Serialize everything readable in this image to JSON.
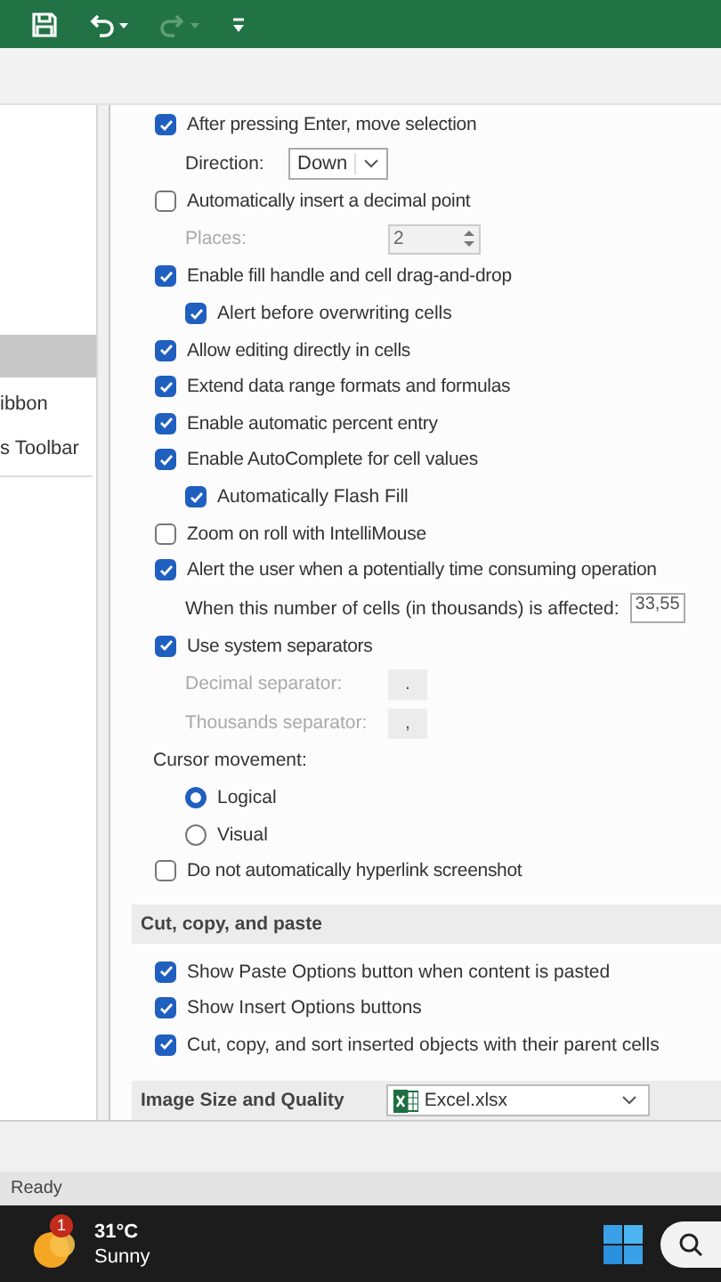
{
  "quick_access": [
    {
      "kind": "save",
      "disabled": false
    },
    {
      "kind": "undo",
      "disabled": false
    },
    {
      "kind": "redo",
      "disabled": true
    },
    {
      "kind": "customize",
      "disabled": false
    }
  ],
  "sidebar": {
    "items": [
      {
        "selected": true
      },
      {
        "label": "ibbon",
        "selected": false
      },
      {
        "label": "s Toolbar",
        "selected": false
      }
    ]
  },
  "editing_options": [
    {
      "kind": "checkbox",
      "label": "After pressing Enter, move selection",
      "checked": true,
      "children": [
        {
          "kind": "dropdown",
          "label": "Direction:",
          "value": "Down",
          "disabled": false
        }
      ]
    },
    {
      "kind": "checkbox",
      "label": "Automatically insert a decimal point",
      "checked": false,
      "children": [
        {
          "kind": "spinner",
          "label": "Places:",
          "value": "2",
          "disabled": true
        }
      ]
    },
    {
      "kind": "checkbox",
      "label": "Enable fill handle and cell drag-and-drop",
      "checked": true,
      "children": [
        {
          "kind": "checkbox",
          "label": "Alert before overwriting cells",
          "checked": true
        }
      ]
    },
    {
      "kind": "checkbox",
      "label": "Allow editing directly in cells",
      "checked": true
    },
    {
      "kind": "checkbox",
      "label": "Extend data range formats and formulas",
      "checked": true
    },
    {
      "kind": "checkbox",
      "label": "Enable automatic percent entry",
      "checked": true
    },
    {
      "kind": "checkbox",
      "label": "Enable AutoComplete for cell values",
      "checked": true,
      "children": [
        {
          "kind": "checkbox",
          "label": "Automatically Flash Fill",
          "checked": true
        }
      ]
    },
    {
      "kind": "checkbox",
      "label": "Zoom on roll with IntelliMouse",
      "checked": false
    },
    {
      "kind": "checkbox",
      "label": "Alert the user when a potentially time consuming operation",
      "checked": true,
      "children": [
        {
          "kind": "number",
          "label": "When this number of cells (in thousands) is affected:",
          "value": "33,55",
          "disabled": false
        }
      ]
    },
    {
      "kind": "checkbox",
      "label": "Use system separators",
      "checked": true,
      "children": [
        {
          "kind": "text",
          "label": "Decimal separator:",
          "value": ".",
          "disabled": true
        },
        {
          "kind": "text",
          "label": "Thousands separator:",
          "value": ",",
          "disabled": true
        }
      ]
    },
    {
      "kind": "radio_group",
      "label": "Cursor movement:",
      "children": [
        {
          "kind": "radio",
          "label": "Logical",
          "selected": true
        },
        {
          "kind": "radio",
          "label": "Visual",
          "selected": false
        }
      ]
    },
    {
      "kind": "checkbox",
      "label": "Do not automatically hyperlink screenshot",
      "checked": false
    }
  ],
  "sections": [
    {
      "title": "Cut, copy, and paste",
      "options": [
        {
          "kind": "checkbox",
          "label": "Show Paste Options button when content is pasted",
          "checked": true
        },
        {
          "kind": "checkbox",
          "label": "Show Insert Options buttons",
          "checked": true
        },
        {
          "kind": "checkbox",
          "label": "Cut, copy, and sort inserted objects with their parent cells",
          "checked": true
        }
      ]
    },
    {
      "title": "Image Size and Quality",
      "dropdown": {
        "value": "Excel.xlsx"
      }
    }
  ],
  "status_bar": {
    "text": "Ready"
  },
  "taskbar": {
    "weather": {
      "badge": "1",
      "temperature": "31°C",
      "condition": "Sunny"
    }
  }
}
